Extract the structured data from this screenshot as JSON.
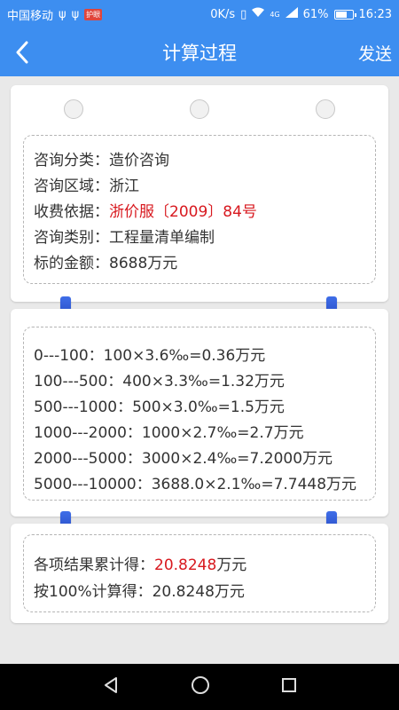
{
  "status_bar": {
    "carrier": "中国移动",
    "badge": "护眼",
    "speed": "0K/s",
    "signal": "4G",
    "battery_percent": "61%",
    "battery_level": 0.61,
    "time": "16:23"
  },
  "app_bar": {
    "title": "计算过程",
    "send_label": "发送"
  },
  "info": {
    "category_label": "咨询分类：",
    "category_value": "造价咨询",
    "region_label": "咨询区域：",
    "region_value": "浙江",
    "basis_label": "收费依据：",
    "basis_value": "浙价服〔2009〕84号",
    "type_label": "咨询类别：",
    "type_value": "工程量清单编制",
    "amount_label": "标的金额：",
    "amount_value": "8688万元"
  },
  "calculation": {
    "rows": [
      "0---100：100×3.6‰=0.36万元",
      "100---500：400×3.3‰=1.32万元",
      "500---1000：500×3.0‰=1.5万元",
      "1000---2000：1000×2.7‰=2.7万元",
      "2000---5000：3000×2.4‰=7.2000万元",
      "5000---10000：3688.0×2.1‰=7.7448万元"
    ]
  },
  "result": {
    "cumulative_label": "各项结果累计得：",
    "cumulative_value": "20.8248",
    "cumulative_unit": "万元",
    "percent_line": "按100%计算得：20.8248万元"
  },
  "colors": {
    "primary": "#3d8ef0",
    "highlight": "#d8191f",
    "clip": "#2f5bd8"
  },
  "icons": {
    "back": "chevron-left-icon",
    "nav_back": "triangle-back-icon",
    "nav_home": "circle-home-icon",
    "nav_recent": "square-recent-icon"
  }
}
